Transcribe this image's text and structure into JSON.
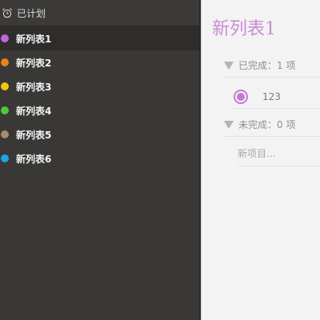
{
  "sidebar": {
    "header_label": "已计划",
    "header_icon": "alarm-clock-icon",
    "lists": [
      {
        "label": "新列表1",
        "color": "#c066d8",
        "selected": true
      },
      {
        "label": "新列表2",
        "color": "#f07f18",
        "selected": false
      },
      {
        "label": "新列表3",
        "color": "#f2c80f",
        "selected": false
      },
      {
        "label": "新列表4",
        "color": "#4fc83a",
        "selected": false
      },
      {
        "label": "新列表5",
        "color": "#a8896a",
        "selected": false
      },
      {
        "label": "新列表6",
        "color": "#1aa6e8",
        "selected": false
      }
    ]
  },
  "main": {
    "title": "新列表1",
    "title_color": "#c98bd4",
    "completed_label": "已完成：1 项",
    "tasks": [
      {
        "text": "123",
        "done": true
      }
    ],
    "incomplete_label": "未完成：0 项",
    "new_item_placeholder": "新项目..."
  }
}
